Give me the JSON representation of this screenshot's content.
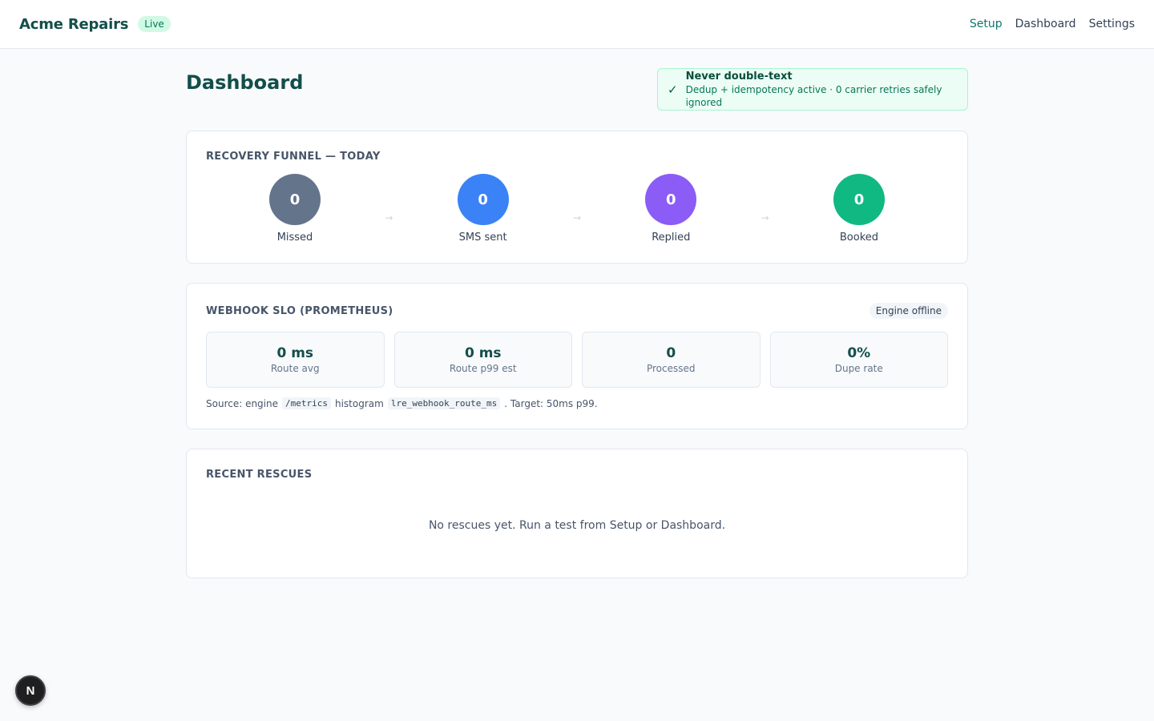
{
  "header": {
    "brand": "Acme Repairs",
    "status_badge": "Live",
    "nav": [
      {
        "label": "Setup"
      },
      {
        "label": "Dashboard"
      },
      {
        "label": "Settings"
      }
    ]
  },
  "page": {
    "title": "Dashboard"
  },
  "guard": {
    "check_icon": "✓",
    "title": "Never double-text",
    "subtitle": "Dedup + idempotency active · 0 carrier retries safely ignored"
  },
  "funnel": {
    "title": "Recovery funnel — today",
    "arrow": "→",
    "steps": [
      {
        "value": "0",
        "label": "Missed",
        "color": "#64748b"
      },
      {
        "value": "0",
        "label": "SMS sent",
        "color": "#3b82f6"
      },
      {
        "value": "0",
        "label": "Replied",
        "color": "#8b5cf6"
      },
      {
        "value": "0",
        "label": "Booked",
        "color": "#10b981"
      }
    ]
  },
  "slo": {
    "title": "Webhook SLO (Prometheus)",
    "badge": "Engine offline",
    "metrics": [
      {
        "value": "0 ms",
        "label": "Route avg"
      },
      {
        "value": "0 ms",
        "label": "Route p99 est"
      },
      {
        "value": "0",
        "label": "Processed"
      },
      {
        "value": "0%",
        "label": "Dupe rate"
      }
    ],
    "source_prefix": "Source: engine",
    "source_code1": "/metrics",
    "source_mid": "histogram",
    "source_code2": "lre_webhook_route_ms",
    "source_suffix": ". Target: 50ms p99."
  },
  "rescues": {
    "title": "Recent rescues",
    "empty_text": "No rescues yet. Run a test from Setup or Dashboard."
  },
  "dev_badge": {
    "letter": "N"
  },
  "colors": {
    "brand": "#134e4a",
    "accent": "#0f766e",
    "success_bg": "#ecfdf5"
  }
}
